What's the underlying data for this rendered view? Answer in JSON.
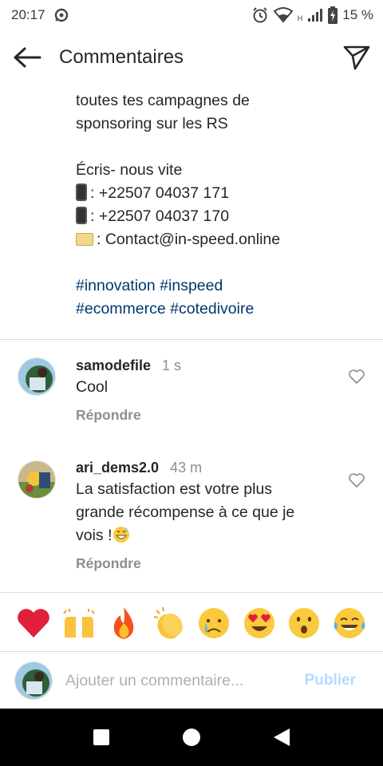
{
  "status_bar": {
    "time": "20:17",
    "battery": "15 %",
    "network": "H"
  },
  "header": {
    "title": "Commentaires",
    "back_icon": "arrow-left-icon",
    "send_icon": "paper-plane-icon"
  },
  "caption": {
    "line1": "toutes tes campagnes de",
    "line2": "sponsoring sur les RS",
    "line3": "Écris- nous vite",
    "phone1": ": +22507 04037 171",
    "phone2": ": +22507 04037 170",
    "email": ": Contact@in-speed.online",
    "hashtags_line1": [
      "#innovation",
      "#inspeed"
    ],
    "hashtags_line2": [
      "#ecommerce",
      "#cotedivoire"
    ]
  },
  "comments": [
    {
      "username": "samodefile",
      "time": "1 s",
      "text": "Cool",
      "reply_label": "Répondre"
    },
    {
      "username": "ari_dems2.0",
      "time": "43 m",
      "text_line1": "La satisfaction est votre plus",
      "text_line2": "grande récompense à ce que je",
      "text_line3": "vois !",
      "reply_label": "Répondre"
    }
  ],
  "emoji_bar": [
    "red-heart",
    "raised-hands",
    "fire",
    "clapping-hands",
    "crying-face",
    "heart-eyes",
    "astonished-face",
    "tears-of-joy"
  ],
  "composer": {
    "placeholder": "Ajouter un commentaire...",
    "publish_label": "Publier"
  },
  "colors": {
    "hashtag": "#00376b",
    "publish_disabled": "#b3dbff",
    "secondary_text": "#8e8e8e"
  }
}
